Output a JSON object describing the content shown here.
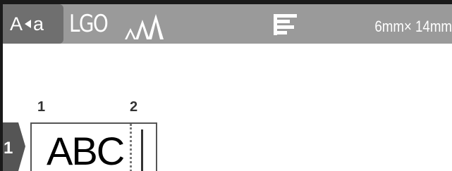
{
  "status_bar": {
    "input_mode": {
      "upper": "A",
      "lower": "a",
      "icon": "mode-arrow-icon"
    },
    "font": "LGO",
    "char_size_icon": "character-size-icon",
    "alignment_icon": "align-left-icon",
    "tape_size": "6mm× 14mm"
  },
  "editor": {
    "ruler_numbers": [
      "1",
      "2"
    ],
    "line_number": "1",
    "label_text": "ABC"
  },
  "colors": {
    "status_bar_bg": "#9a9a9a",
    "mode_box_bg": "#6f6f6f",
    "text_on_bar": "#ffffff",
    "frame_border": "#555555",
    "line_marker_bg": "#555555"
  }
}
